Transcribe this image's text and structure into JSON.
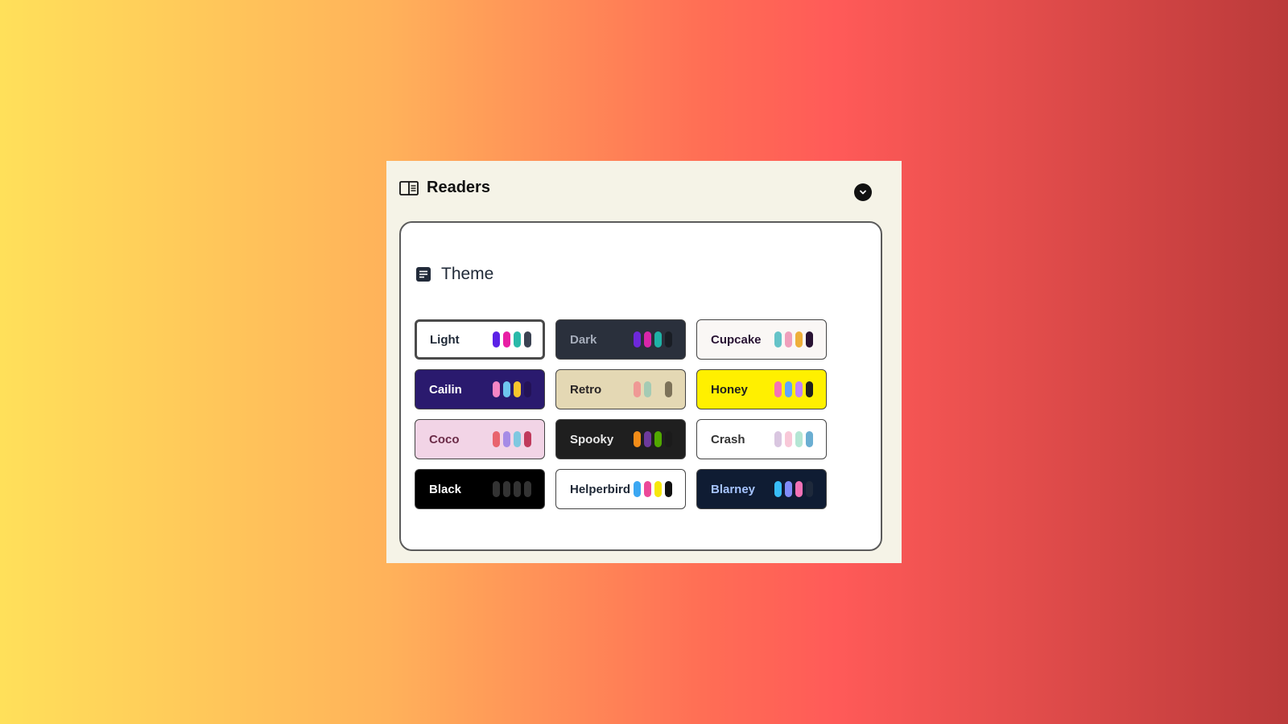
{
  "panel": {
    "title": "Readers",
    "title_icon": "book-reader-icon",
    "collapse_icon": "chevron-down-icon"
  },
  "theme_section": {
    "title": "Theme",
    "title_icon": "document-lines-icon",
    "selected": "Light",
    "themes": [
      {
        "label": "Light",
        "bg": "#ffffff",
        "text": "#1f2937",
        "swatches": [
          "#5b21e6",
          "#e81fa4",
          "#2bb9a9",
          "#3b4252"
        ]
      },
      {
        "label": "Dark",
        "bg": "#2a303c",
        "text": "#a6adbb",
        "swatches": [
          "#6d28d9",
          "#d926a9",
          "#1fb2a6",
          "#191d24"
        ]
      },
      {
        "label": "Cupcake",
        "bg": "#faf7f5",
        "text": "#291334",
        "swatches": [
          "#65c3c8",
          "#ef9fbc",
          "#eeaf3a",
          "#291334"
        ]
      },
      {
        "label": "Cailin",
        "bg": "#2a1a6e",
        "text": "#ffffff",
        "swatches": [
          "#f585c5",
          "#6ec6ee",
          "#f7c52c",
          "#231257"
        ]
      },
      {
        "label": "Retro",
        "bg": "#e4d8b4",
        "text": "#282425",
        "swatches": [
          "#ef9995",
          "#a4cbb4",
          "#e4d8b4",
          "#7d7259"
        ]
      },
      {
        "label": "Honey",
        "bg": "#fff000",
        "text": "#1f1f1f",
        "swatches": [
          "#f472b6",
          "#60a5fa",
          "#c084fc",
          "#1f1f1f"
        ]
      },
      {
        "label": "Coco",
        "bg": "#f2d4e6",
        "text": "#6b2c48",
        "swatches": [
          "#e8646e",
          "#a68ce6",
          "#7fc8e0",
          "#c03a5c"
        ]
      },
      {
        "label": "Spooky",
        "bg": "#1f1f1f",
        "text": "#e8e8e8",
        "swatches": [
          "#f28c18",
          "#6d3a9c",
          "#51a800",
          "#1b1b1b"
        ]
      },
      {
        "label": "Crash",
        "bg": "#ffffff",
        "text": "#333333",
        "swatches": [
          "#d9c6e0",
          "#f8c8d8",
          "#b4e6d4",
          "#6aaed2"
        ]
      },
      {
        "label": "Black",
        "bg": "#000000",
        "text": "#ffffff",
        "swatches": [
          "#333333",
          "#333333",
          "#333333",
          "#333333"
        ]
      },
      {
        "label": "Helperbird",
        "bg": "#ffffff",
        "text": "#1f2937",
        "swatches": [
          "#3ba7f2",
          "#ec4899",
          "#f7e70c",
          "#111111"
        ]
      },
      {
        "label": "Blarney",
        "bg": "#0f1c33",
        "text": "#a6c4ff",
        "swatches": [
          "#38bdf8",
          "#818cf8",
          "#f472b6",
          "#1e293b"
        ]
      }
    ]
  }
}
